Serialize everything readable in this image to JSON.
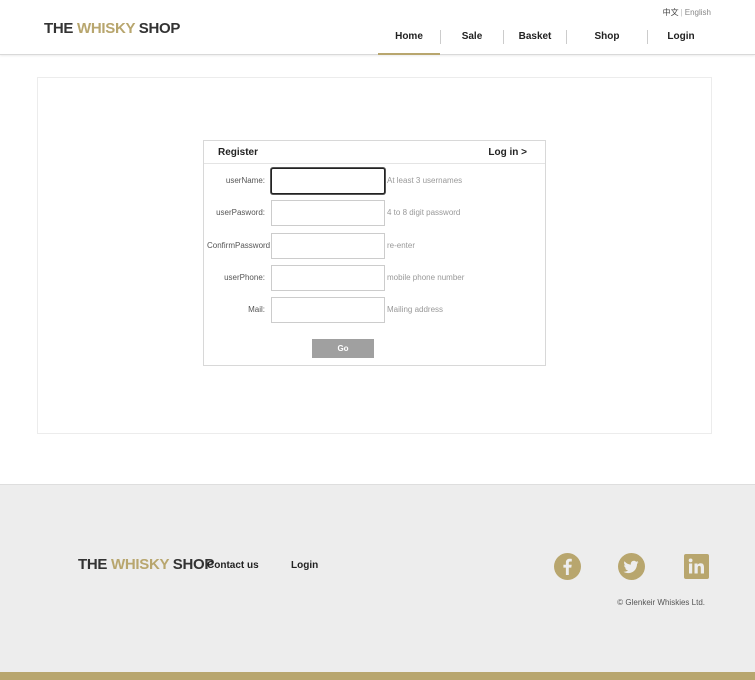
{
  "header": {
    "logo": {
      "part1": "THE",
      "part2": "WHISKY",
      "part3": "SHOP"
    },
    "lang": {
      "chinese": "中文",
      "separator": "|",
      "english": "English"
    },
    "nav": [
      {
        "label": "Home",
        "active": true
      },
      {
        "label": "Sale",
        "active": false
      },
      {
        "label": "Basket",
        "active": false
      },
      {
        "label": "Shop",
        "active": false
      },
      {
        "label": "Login",
        "active": false
      }
    ]
  },
  "form": {
    "title": "Register",
    "login_link": "Log in >",
    "fields": [
      {
        "label": "userName:",
        "value": "",
        "hint": "At least 3 usernames",
        "focused": true
      },
      {
        "label": "userPasword:",
        "value": "",
        "hint": "4 to 8 digit password"
      },
      {
        "label": "ConfirmPassword",
        "value": "",
        "hint": "re-enter"
      },
      {
        "label": "userPhone:",
        "value": "",
        "hint": "mobile phone number"
      },
      {
        "label": "Mail:",
        "value": "",
        "hint": "Mailing address"
      }
    ],
    "submit_label": "Go"
  },
  "footer": {
    "logo": {
      "part1": "THE",
      "part2": "WHISKY",
      "part3": "SHOP"
    },
    "links": [
      "Contact us",
      "Login"
    ],
    "social": [
      "facebook-icon",
      "twitter-icon",
      "linkedin-icon"
    ],
    "copyright": "© Glenkeir Whiskies Ltd.",
    "accent_color": "#b8a66e"
  },
  "colors": {
    "accent": "#b8a66e",
    "button_gray": "#a0a0a0",
    "footer_bg": "#ededed"
  }
}
